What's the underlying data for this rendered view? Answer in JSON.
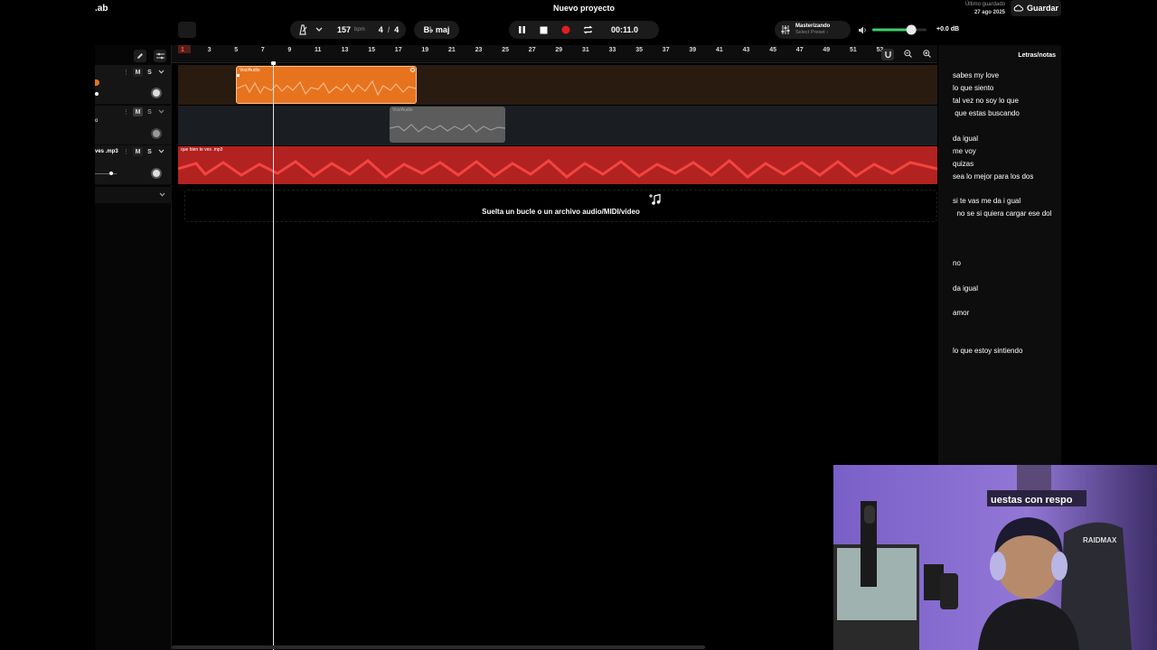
{
  "app": {
    "brand": ".ab",
    "project_title": "Nuevo proyecto"
  },
  "header": {
    "tempo": "157",
    "tempo_unit": "bpm",
    "time_sig_top": "4",
    "time_sig_sep": "/",
    "time_sig_bottom": "4",
    "key": "B♭ maj",
    "time_display": "00:11.0",
    "master_title": "Masterizando",
    "master_sub": "Select Preset ›",
    "volume_db": "+0.0 dB",
    "volume_level": 0.72,
    "last_saved_label": "Último guardado",
    "last_saved_date": "27 ago 2025",
    "save_label": "Guardar"
  },
  "ruler": {
    "bars": [
      "1",
      "3",
      "5",
      "7",
      "9",
      "11",
      "13",
      "15",
      "17",
      "19",
      "21",
      "23",
      "25",
      "27",
      "29",
      "31",
      "33",
      "35",
      "37",
      "39",
      "41",
      "43",
      "45",
      "47",
      "49",
      "51",
      "53"
    ]
  },
  "tracks": [
    {
      "name": "",
      "mute": "M",
      "solo": "S",
      "clip_label": "Voz/Audio",
      "color": "#e8731e"
    },
    {
      "name": "o",
      "mute": "M",
      "solo": "S",
      "clip_label": "Voz/Audio",
      "color": "#8a8a8a"
    },
    {
      "name": "ves .mp3",
      "mute": "M",
      "solo": "S",
      "clip_label": "que bien te ves .mp3",
      "color": "#d42a2a"
    }
  ],
  "drop_hint": "Suelta un bucle o un archivo audio/MIDI/video",
  "lyrics": {
    "title": "Letras/notas",
    "lines": [
      "sabes my love",
      "lo que siento",
      "tal vez no soy lo que",
      " que estas buscando",
      "da igual",
      "me voy",
      "quizas",
      "sea lo mejor para los dos",
      "si te vas me da i gual",
      "  no se si quiera cargar ese dol",
      "no",
      "da igual",
      "amor",
      "lo que estoy sintiendo"
    ]
  },
  "webcam": {
    "neon_text": "uestas con respo",
    "chair_brand": "RAIDMAX"
  },
  "colors": {
    "accent": "#e8731e",
    "record": "#e0201d",
    "volume": "#3fcf6a"
  }
}
